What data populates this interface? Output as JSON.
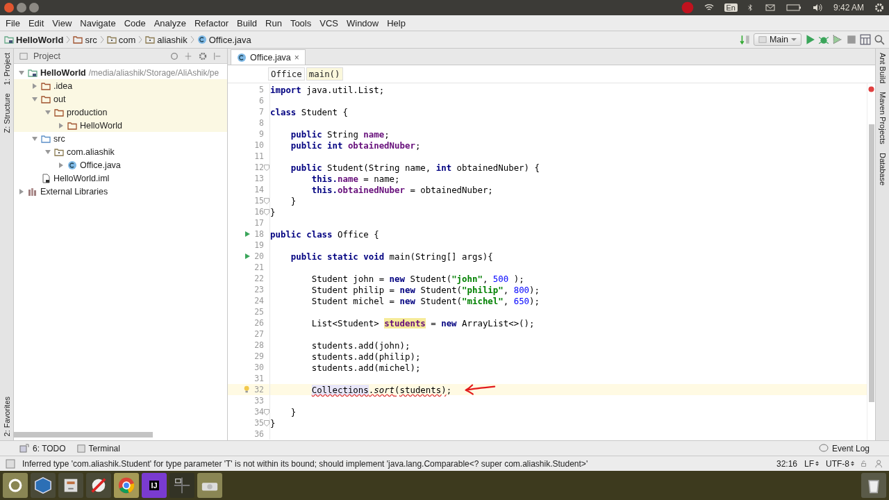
{
  "system_bar": {
    "language": "En",
    "time": "9:42 AM"
  },
  "menu": [
    "File",
    "Edit",
    "View",
    "Navigate",
    "Code",
    "Analyze",
    "Refactor",
    "Build",
    "Run",
    "Tools",
    "VCS",
    "Window",
    "Help"
  ],
  "nav_path": [
    {
      "label": "HelloWorld",
      "kind": "module"
    },
    {
      "label": "src",
      "kind": "folder"
    },
    {
      "label": "com",
      "kind": "package"
    },
    {
      "label": "aliashik",
      "kind": "package"
    },
    {
      "label": "Office.java",
      "kind": "class"
    }
  ],
  "run_config": "Main",
  "left_strip": [
    "1: Project",
    "Z: Structure",
    "2: Favorites"
  ],
  "right_strip": [
    "Ant Build",
    "Maven Projects",
    "Database"
  ],
  "project_panel": {
    "title": "Project",
    "tree": [
      {
        "label": "HelloWorld",
        "path": "/media/aliashik/Storage/AliAshik/pe",
        "kind": "module",
        "expanded": true,
        "excluded": false,
        "children": [
          {
            "label": ".idea",
            "kind": "folder",
            "expanded": false,
            "excluded": true
          },
          {
            "label": "out",
            "kind": "folder",
            "expanded": true,
            "excluded": true,
            "children": [
              {
                "label": "production",
                "kind": "folder",
                "expanded": true,
                "excluded": true,
                "children": [
                  {
                    "label": "HelloWorld",
                    "kind": "folder",
                    "expanded": false,
                    "excluded": true
                  }
                ]
              }
            ]
          },
          {
            "label": "src",
            "kind": "source",
            "expanded": true,
            "excluded": false,
            "children": [
              {
                "label": "com.aliashik",
                "kind": "package",
                "expanded": true,
                "excluded": false,
                "children": [
                  {
                    "label": "Office.java",
                    "kind": "class",
                    "expanded": false,
                    "excluded": false
                  }
                ]
              }
            ]
          },
          {
            "label": "HelloWorld.iml",
            "kind": "file",
            "excluded": false
          }
        ]
      },
      {
        "label": "External Libraries",
        "kind": "library",
        "expanded": false,
        "excluded": false
      }
    ]
  },
  "editor": {
    "tab": {
      "label": "Office.java",
      "close": "×"
    },
    "breadcrumb": [
      {
        "label": "Office",
        "selected": false
      },
      {
        "label": "main()",
        "selected": true
      }
    ],
    "lines": [
      {
        "n": "5",
        "tokens": [
          {
            "t": "import",
            "kind": "kw"
          },
          {
            "t": " java.util.List;",
            "kind": "plain"
          }
        ]
      },
      {
        "n": "6"
      },
      {
        "n": "7",
        "tokens": [
          {
            "t": "class",
            "kind": "kw"
          },
          {
            "t": " Student {",
            "kind": "plain"
          }
        ]
      },
      {
        "n": "8"
      },
      {
        "n": "9",
        "tokens": [
          {
            "t": "    public",
            "kind": "kw"
          },
          {
            "t": " String ",
            "kind": "plain"
          },
          {
            "t": "name",
            "kind": "field"
          },
          {
            "t": ";",
            "kind": "plain"
          }
        ]
      },
      {
        "n": "10",
        "tokens": [
          {
            "t": "    public int ",
            "kind": "kw"
          },
          {
            "t": "obtainedNuber",
            "kind": "field"
          },
          {
            "t": ";",
            "kind": "plain"
          }
        ]
      },
      {
        "n": "11"
      },
      {
        "n": "12",
        "kind": "fold",
        "tokens": [
          {
            "t": "    public",
            "kind": "kw"
          },
          {
            "t": " Student(String name, ",
            "kind": "plain"
          },
          {
            "t": "int",
            "kind": "kw"
          },
          {
            "t": " obtainedNuber) {",
            "kind": "plain"
          }
        ]
      },
      {
        "n": "13",
        "tokens": [
          {
            "t": "        this.",
            "kind": "kw"
          },
          {
            "t": "name",
            "kind": "field"
          },
          {
            "t": " = name;",
            "kind": "plain"
          }
        ]
      },
      {
        "n": "14",
        "tokens": [
          {
            "t": "        this.",
            "kind": "kw"
          },
          {
            "t": "obtainedNuber",
            "kind": "field"
          },
          {
            "t": " = obtainedNuber;",
            "kind": "plain"
          }
        ]
      },
      {
        "n": "15",
        "kind": "fold",
        "tokens": [
          {
            "t": "    }",
            "kind": "plain"
          }
        ]
      },
      {
        "n": "16",
        "kind": "fold",
        "tokens": [
          {
            "t": "}",
            "kind": "plain"
          }
        ]
      },
      {
        "n": "17"
      },
      {
        "n": "18",
        "kind": "run",
        "tokens": [
          {
            "t": "public class",
            "kind": "kw"
          },
          {
            "t": " Office {",
            "kind": "plain"
          }
        ]
      },
      {
        "n": "19"
      },
      {
        "n": "20",
        "kind": "run",
        "tokens": [
          {
            "t": "    public static void",
            "kind": "kw"
          },
          {
            "t": " main(String[] args){",
            "kind": "plain"
          }
        ]
      },
      {
        "n": "21"
      },
      {
        "n": "22",
        "tokens": [
          {
            "t": "        Student john = ",
            "kind": "plain"
          },
          {
            "t": "new",
            "kind": "kw"
          },
          {
            "t": " Student(",
            "kind": "plain"
          },
          {
            "t": "\"john\"",
            "kind": "str"
          },
          {
            "t": ", ",
            "kind": "plain"
          },
          {
            "t": "500",
            "kind": "num"
          },
          {
            "t": " );",
            "kind": "plain"
          }
        ]
      },
      {
        "n": "23",
        "tokens": [
          {
            "t": "        Student philip = ",
            "kind": "plain"
          },
          {
            "t": "new",
            "kind": "kw"
          },
          {
            "t": " Student(",
            "kind": "plain"
          },
          {
            "t": "\"philip\"",
            "kind": "str"
          },
          {
            "t": ", ",
            "kind": "plain"
          },
          {
            "t": "800",
            "kind": "num"
          },
          {
            "t": ");",
            "kind": "plain"
          }
        ]
      },
      {
        "n": "24",
        "tokens": [
          {
            "t": "        Student michel = ",
            "kind": "plain"
          },
          {
            "t": "new",
            "kind": "kw"
          },
          {
            "t": " Student(",
            "kind": "plain"
          },
          {
            "t": "\"michel\"",
            "kind": "str"
          },
          {
            "t": ", ",
            "kind": "plain"
          },
          {
            "t": "650",
            "kind": "num"
          },
          {
            "t": ");",
            "kind": "plain"
          }
        ]
      },
      {
        "n": "25"
      },
      {
        "n": "26",
        "tokens": [
          {
            "t": "        List<Student> ",
            "kind": "plain"
          },
          {
            "t": "students",
            "kind": "hl"
          },
          {
            "t": " = ",
            "kind": "plain"
          },
          {
            "t": "new",
            "kind": "kw"
          },
          {
            "t": " ArrayList<>();",
            "kind": "plain"
          }
        ]
      },
      {
        "n": "27"
      },
      {
        "n": "28",
        "tokens": [
          {
            "t": "        students.add(john);",
            "kind": "plain"
          }
        ]
      },
      {
        "n": "29",
        "tokens": [
          {
            "t": "        students.add(philip);",
            "kind": "plain"
          }
        ]
      },
      {
        "n": "30",
        "tokens": [
          {
            "t": "        students.add(michel);",
            "kind": "plain"
          }
        ]
      },
      {
        "n": "31"
      },
      {
        "n": "32",
        "kind": "bulb",
        "current": true,
        "tokens": [
          {
            "t": "        Collections",
            "kind": "errhl"
          },
          {
            "t": ".",
            "kind": "err"
          },
          {
            "t": "sort",
            "kind": "erritalic"
          },
          {
            "t": "(students)",
            "kind": "err"
          },
          {
            "t": ";",
            "kind": "plain"
          }
        ]
      },
      {
        "n": "33"
      },
      {
        "n": "34",
        "kind": "fold",
        "tokens": [
          {
            "t": "    }",
            "kind": "plain"
          }
        ]
      },
      {
        "n": "35",
        "kind": "fold",
        "tokens": [
          {
            "t": "}",
            "kind": "plain"
          }
        ]
      },
      {
        "n": "36"
      }
    ]
  },
  "tool_tabs": [
    {
      "label": "6: TODO",
      "kind": "todo"
    },
    {
      "label": "Terminal",
      "kind": "terminal"
    }
  ],
  "event_log": "Event Log",
  "status_bar": {
    "message": "Inferred type 'com.aliashik.Student' for type parameter 'T' is not within its bound; should implement 'java.lang.Comparable<? super com.aliashik.Student>'",
    "position": "32:16",
    "line_sep": "LF",
    "encoding": "UTF-8"
  },
  "launcher": [
    {
      "kind": "ubuntu"
    },
    {
      "kind": "cube"
    },
    {
      "kind": "cabinet"
    },
    {
      "kind": "tools"
    },
    {
      "kind": "browser"
    },
    {
      "kind": "ide",
      "label": "IJ"
    },
    {
      "kind": "workspaces"
    },
    {
      "kind": "drive"
    }
  ]
}
